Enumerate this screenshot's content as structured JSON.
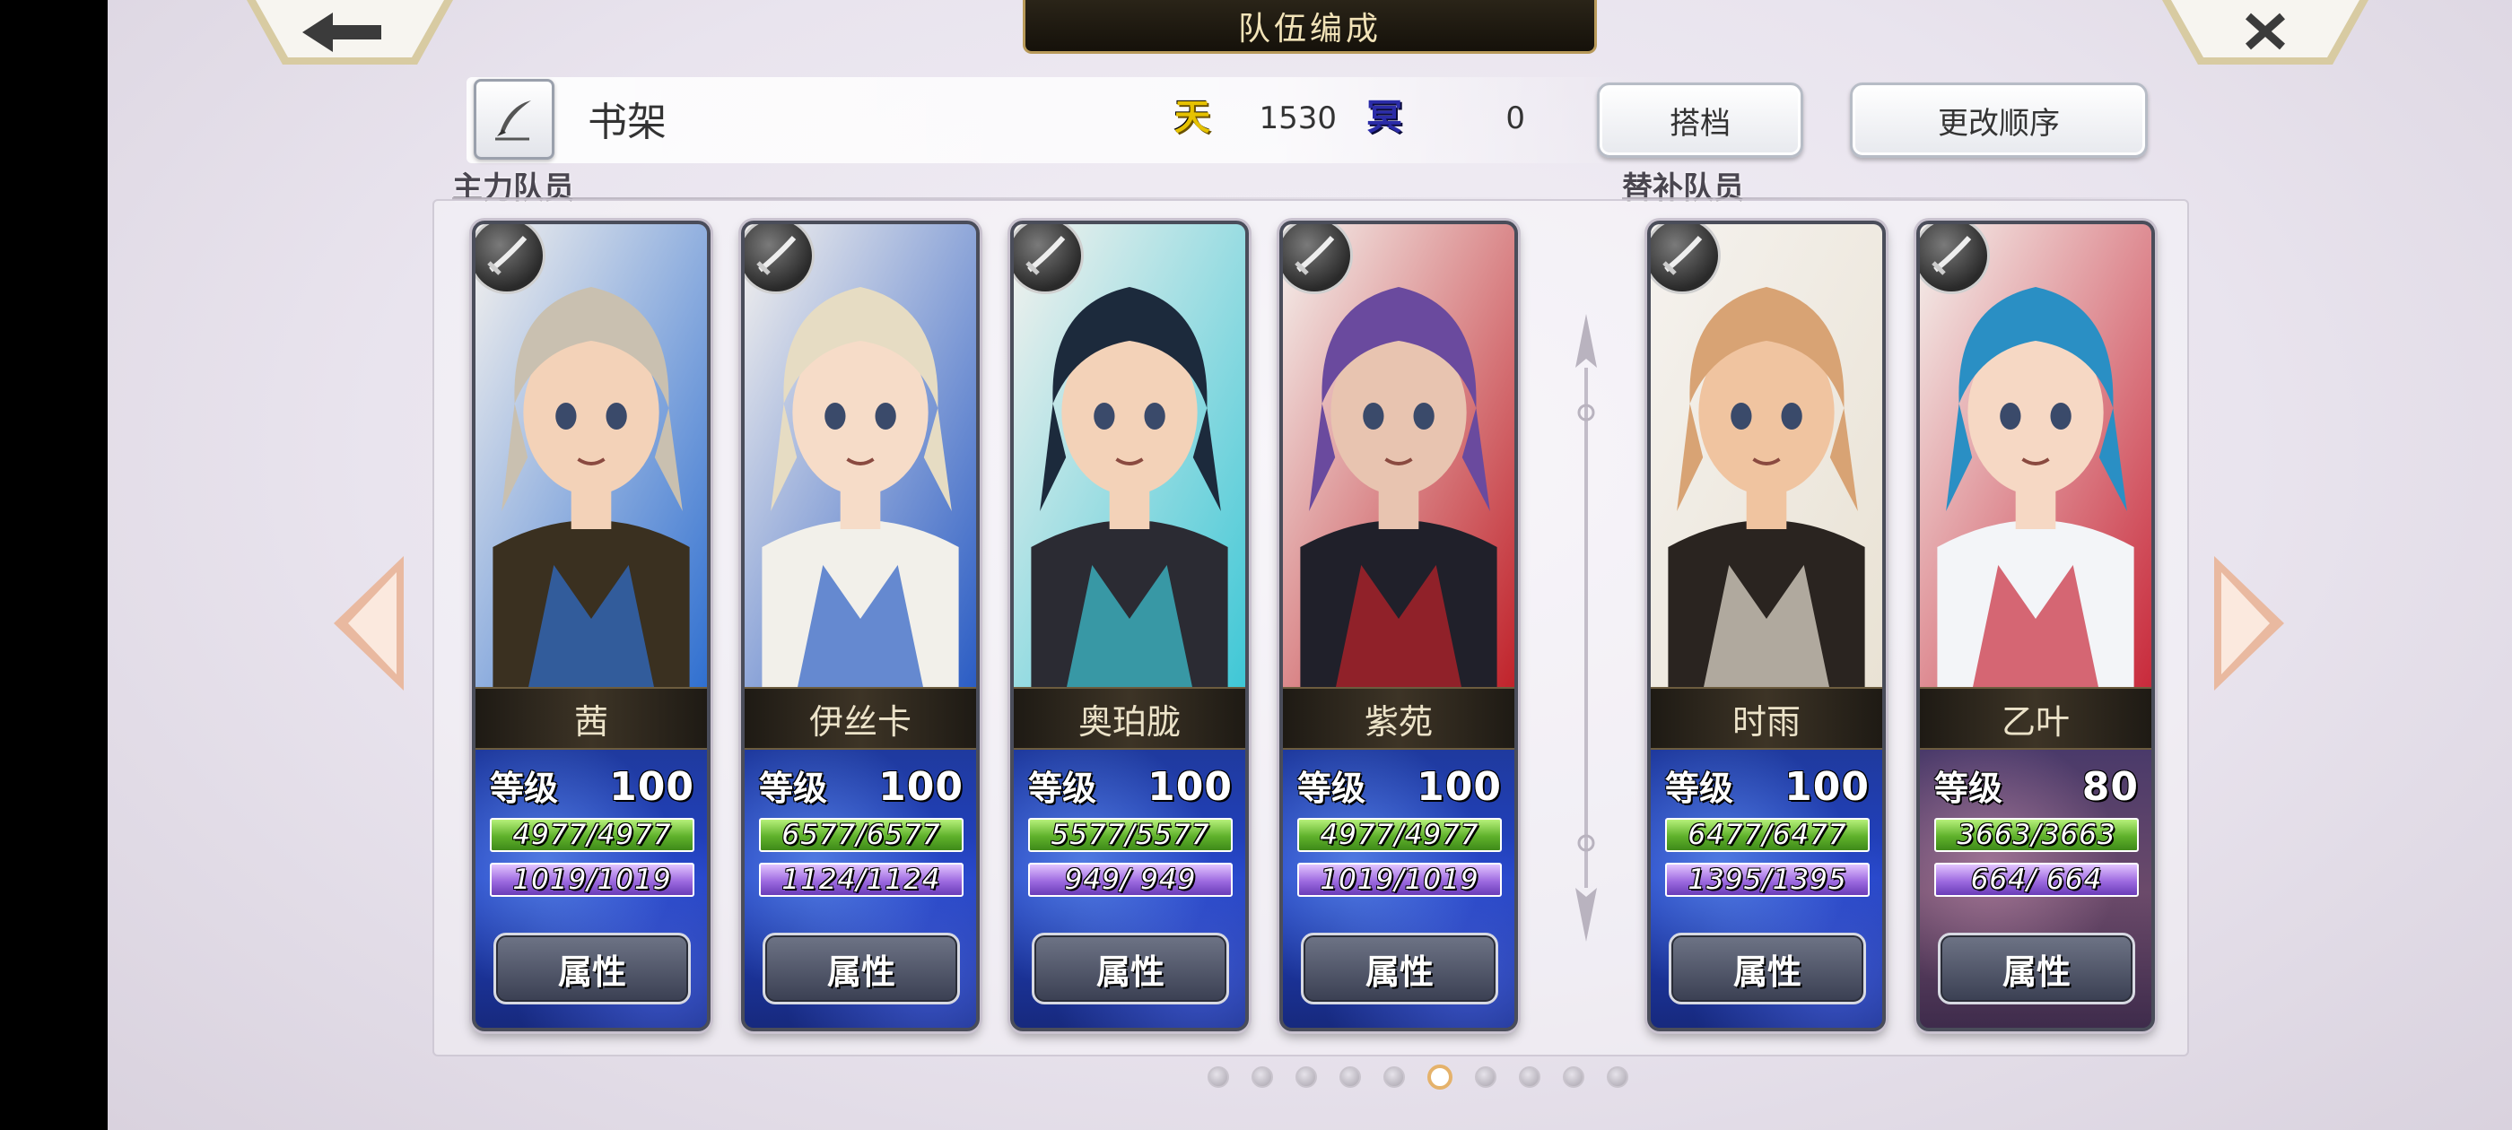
{
  "header": {
    "title": "队伍编成"
  },
  "team": {
    "name": "书架"
  },
  "currency": {
    "heaven_icon": "天",
    "heaven_value": "1530",
    "underworld_icon": "冥",
    "underworld_value": "0"
  },
  "buttons": {
    "formation": "搭档",
    "change_order": "更改顺序"
  },
  "sections": {
    "main": "主力队员",
    "reserve": "替补队员"
  },
  "cards": [
    {
      "name": "茜",
      "level_label": "等级",
      "level": "100",
      "hp": "4977/4977",
      "sp": "1019/1019",
      "attr": "属性",
      "sp_color": "blue",
      "hair": "#c9c0b0",
      "skin": "#f3d2b8",
      "cloth": "#3a3020",
      "accent": "#2f6fd0"
    },
    {
      "name": "伊丝卡",
      "level_label": "等级",
      "level": "100",
      "hp": "6577/6577",
      "sp": "1124/1124",
      "attr": "属性",
      "sp_color": "blue",
      "hair": "#e6dcc3",
      "skin": "#f6dcc8",
      "cloth": "#f2f0ea",
      "accent": "#2a5cc4"
    },
    {
      "name": "奥珀胧",
      "level_label": "等级",
      "level": "100",
      "hp": "5577/5577",
      "sp": "949/ 949",
      "attr": "属性",
      "sp_color": "purple",
      "hair": "#1c2a3c",
      "skin": "#f3d2b8",
      "cloth": "#2b2b33",
      "accent": "#3ec7d6"
    },
    {
      "name": "紫苑",
      "level_label": "等级",
      "level": "100",
      "hp": "4977/4977",
      "sp": "1019/1019",
      "attr": "属性",
      "sp_color": "blue",
      "hair": "#6a4a9e",
      "skin": "#e8c4b0",
      "cloth": "#20202a",
      "accent": "#c0222a"
    },
    {
      "name": "时雨",
      "level_label": "等级",
      "level": "100",
      "hp": "6477/6477",
      "sp": "1395/1395",
      "attr": "属性",
      "sp_color": "blue",
      "hair": "#d8a374",
      "skin": "#f0c4a0",
      "cloth": "#2a2420",
      "accent": "#e9e2d4"
    },
    {
      "name": "乙叶",
      "level_label": "等级",
      "level": "80",
      "hp": "3663/3663",
      "sp": "664/ 664",
      "attr": "属性",
      "sp_color": "purple",
      "hair": "#2a8fc4",
      "skin": "#f6d8c4",
      "cloth": "#f3f5f8",
      "accent": "#c8293a"
    }
  ],
  "pagination": {
    "total": 10,
    "active_index": 5
  },
  "colors": {
    "accent_gold": "#b89a5a",
    "hp_green": "#5fb12b",
    "sp_purple": "#9d6ae0",
    "stats_blue": "#2242c4"
  }
}
